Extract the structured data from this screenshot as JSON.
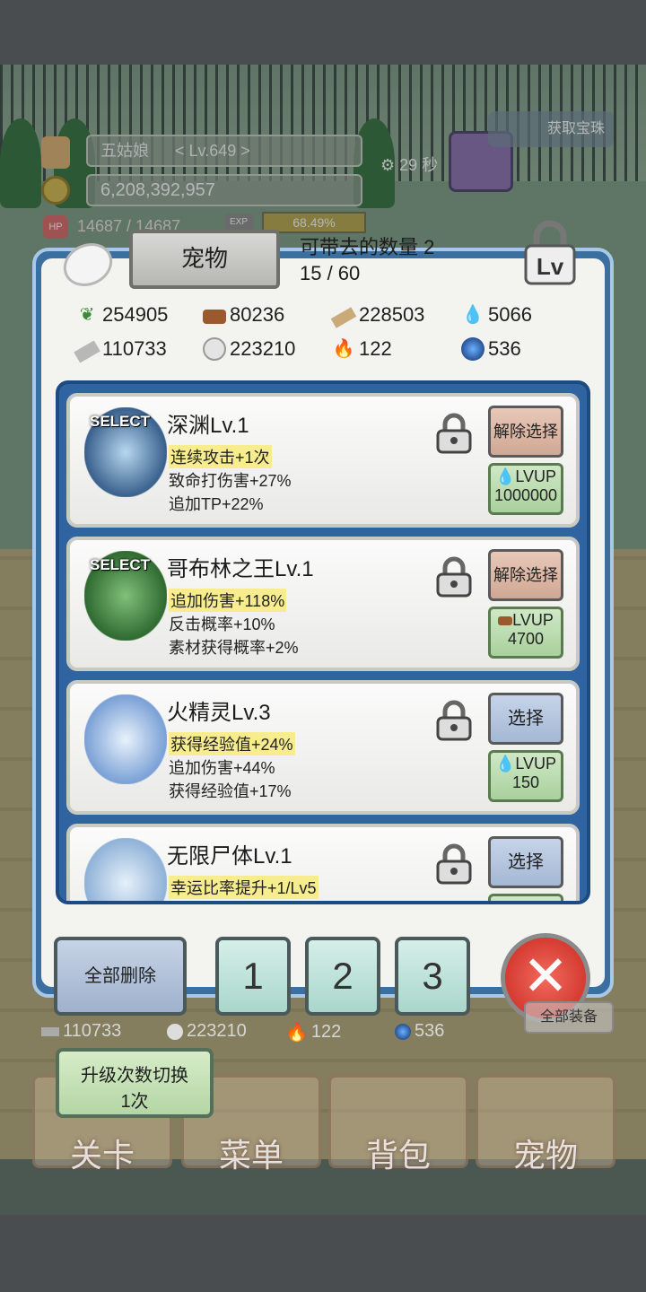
{
  "hud": {
    "player_name": "五姑娘",
    "player_level": "< Lv.649 >",
    "gold": "6,208,392,957",
    "hp_label": "HP",
    "hp": "14687 / 14687",
    "exp_label": "EXP",
    "exp_percent": "68.49%",
    "timer": "29 秒",
    "gift_label": "获取宝珠"
  },
  "panel": {
    "title": "宠物",
    "carry_label": "可带去的数量 2",
    "carry_count": "15 / 60"
  },
  "resources": [
    {
      "icon": "leaf-icon",
      "value": "254905"
    },
    {
      "icon": "wood-log-icon",
      "value": "80236"
    },
    {
      "icon": "wood-plank-icon",
      "value": "228503"
    },
    {
      "icon": "water-drop-icon",
      "value": "5066"
    },
    {
      "icon": "iron-bar-icon",
      "value": "110733"
    },
    {
      "icon": "stone-icon",
      "value": "223210"
    },
    {
      "icon": "blue-flame-icon",
      "value": "122"
    },
    {
      "icon": "dark-orb-icon",
      "value": "536"
    }
  ],
  "pets": [
    {
      "name": "深渊Lv.1",
      "selected_tag": "SELECT",
      "stats": [
        "连续攻击+1次",
        "致命打伤害+27%",
        "追加TP+22%"
      ],
      "select_label": "解除选择",
      "lvup_label": "LVUP",
      "lvup_cost": "1000000",
      "lvup_icon": "water-drop-icon"
    },
    {
      "name": "哥布林之王Lv.1",
      "selected_tag": "SELECT",
      "stats": [
        "追加伤害+118%",
        "反击概率+10%",
        "素材获得概率+2%"
      ],
      "select_label": "解除选择",
      "lvup_label": "LVUP",
      "lvup_cost": "4700",
      "lvup_icon": "wood-log-icon"
    },
    {
      "name": "火精灵Lv.3",
      "selected_tag": "",
      "stats": [
        "获得经验值+24%",
        "追加伤害+44%",
        "获得经验值+17%"
      ],
      "select_label": "选择",
      "lvup_label": "LVUP",
      "lvup_cost": "150",
      "lvup_icon": "water-drop-icon"
    },
    {
      "name": "无限尸体Lv.1",
      "selected_tag": "",
      "stats": [
        "幸运比率提升+1/Lv5",
        "",
        ""
      ],
      "select_label": "选择",
      "lvup_label": "",
      "lvup_cost": "",
      "lvup_icon": ""
    }
  ],
  "footer": {
    "delete_all": "全部删除",
    "slot_1": "1",
    "slot_2": "2",
    "slot_3": "3",
    "upgrade_toggle_line1": "升级次数切换",
    "upgrade_toggle_line2": "1次",
    "equip_all": "全部装备",
    "under_res": [
      "110733",
      "223210",
      "122",
      "536"
    ]
  },
  "nav": [
    "关卡",
    "菜单",
    "背包",
    "宠物"
  ],
  "colors": {
    "panel_border": "#3b6fa0",
    "list_bg": "#2f64a0",
    "highlight_stat": "#f7ed8e",
    "lvup_button": "#a9d19c",
    "close_button": "#c8271e"
  }
}
